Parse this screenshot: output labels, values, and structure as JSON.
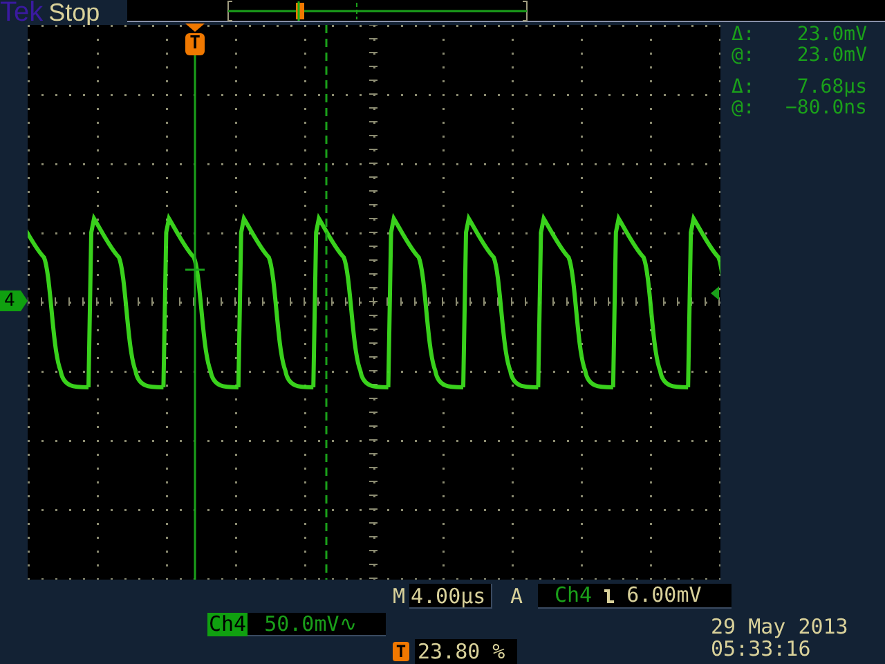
{
  "header": {
    "brand": "Tek",
    "acquisition_state": "Stop"
  },
  "trigger_marker": "T",
  "channel_marker": "4",
  "cursor_readouts": [
    {
      "label": "Δ:",
      "value": "23.0mV"
    },
    {
      "label": "@:",
      "value": "23.0mV"
    },
    {
      "label": "Δ:",
      "value": "7.68µs"
    },
    {
      "label": "@:",
      "value": "−80.0ns"
    }
  ],
  "timebase": {
    "prefix": "M",
    "value": "4.00µs"
  },
  "trigger": {
    "prefix": "A",
    "source": "Ch4",
    "level": "6.00mV"
  },
  "channel_scale": {
    "channel": "Ch4",
    "value": "50.0mV∿"
  },
  "trigger_position": {
    "marker": "T",
    "value": "23.80 %"
  },
  "date": "29 May 2013",
  "time": "05:33:16"
}
